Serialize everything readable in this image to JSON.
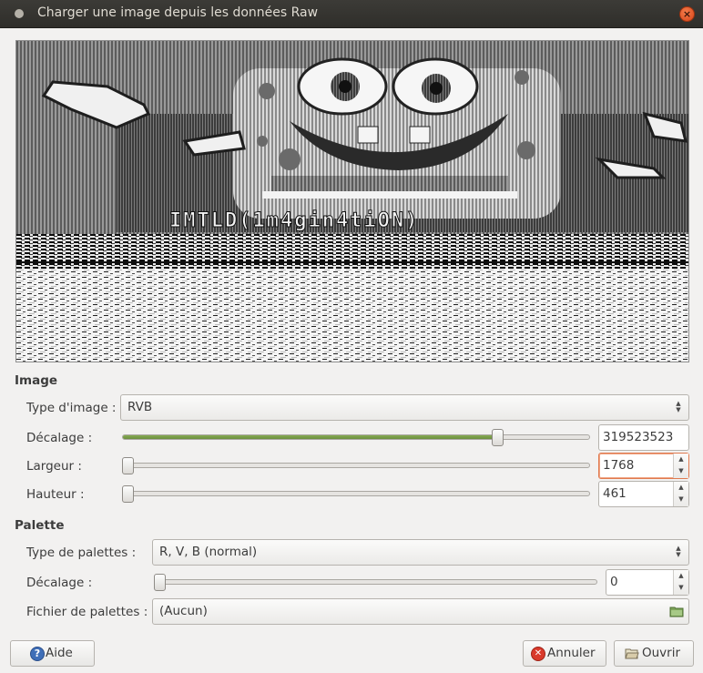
{
  "window": {
    "title": "Charger une image depuis les données Raw",
    "close_glyph": "×"
  },
  "preview": {
    "overlay_text": "IMTLD(1m4gin4tiON)"
  },
  "image_section": {
    "header": "Image",
    "type_label": "Type d'image :",
    "type_value": "RVB",
    "offset_label": "Décalage :",
    "offset_value": "319523523",
    "offset_level": 0.81,
    "width_label": "Largeur :",
    "width_value": "1768",
    "width_level": 0.0,
    "height_label": "Hauteur :",
    "height_value": "461",
    "height_level": 0.0
  },
  "palette_section": {
    "header": "Palette",
    "type_label": "Type de palettes :",
    "type_value": "R, V, B (normal)",
    "offset_label": "Décalage :",
    "offset_value": "0",
    "offset_level": 0.0,
    "file_label": "Fichier de palettes :",
    "file_value": "(Aucun)"
  },
  "buttons": {
    "help": "Aide",
    "cancel": "Annuler",
    "open": "Ouvrir"
  },
  "icons": {
    "help": "help-icon",
    "cancel": "cancel-icon",
    "open": "open-folder-icon",
    "palette_folder": "folder-icon",
    "window": "window-menu-icon",
    "close": "close-icon"
  },
  "colors": {
    "slider_fill": "#7a9c48",
    "focus": "#e07a4f",
    "cancel_red": "#d93a2b",
    "help_blue": "#3f6fb8"
  }
}
